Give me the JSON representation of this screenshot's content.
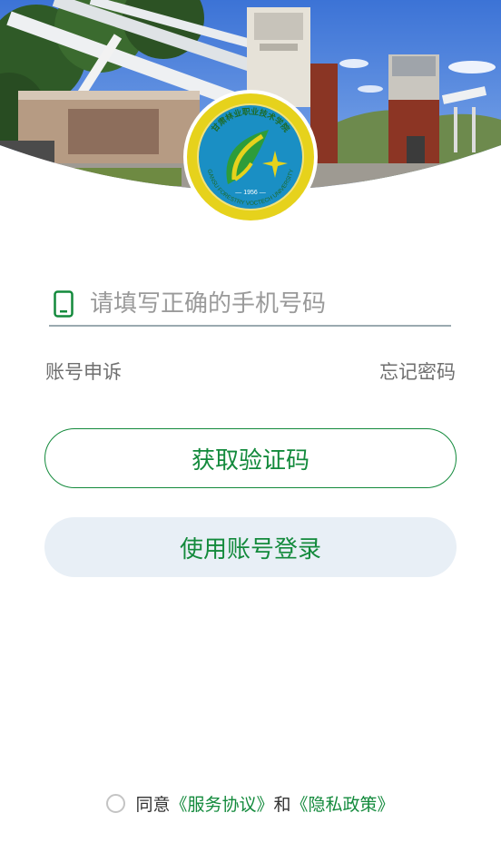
{
  "header": {
    "logo": {
      "text_top": "甘肃林业职业技术学院",
      "text_bottom": "GANSU FORESTRY VOCTECH UNIVERSITY",
      "year": "1956"
    }
  },
  "form": {
    "phone_placeholder": "请填写正确的手机号码",
    "phone_value": "",
    "icon": "mobile-phone-icon"
  },
  "links": {
    "appeal": "账号申诉",
    "forgot": "忘记密码"
  },
  "buttons": {
    "get_code": "获取验证码",
    "account_login": "使用账号登录"
  },
  "agreement": {
    "checked": false,
    "prefix": "同意",
    "service": "《服务协议》",
    "and": "和",
    "privacy": "《隐私政策》"
  },
  "colors": {
    "primary": "#138a3c",
    "secondary_button_bg": "#e8eff6",
    "link_text": "#6f6f6f"
  }
}
